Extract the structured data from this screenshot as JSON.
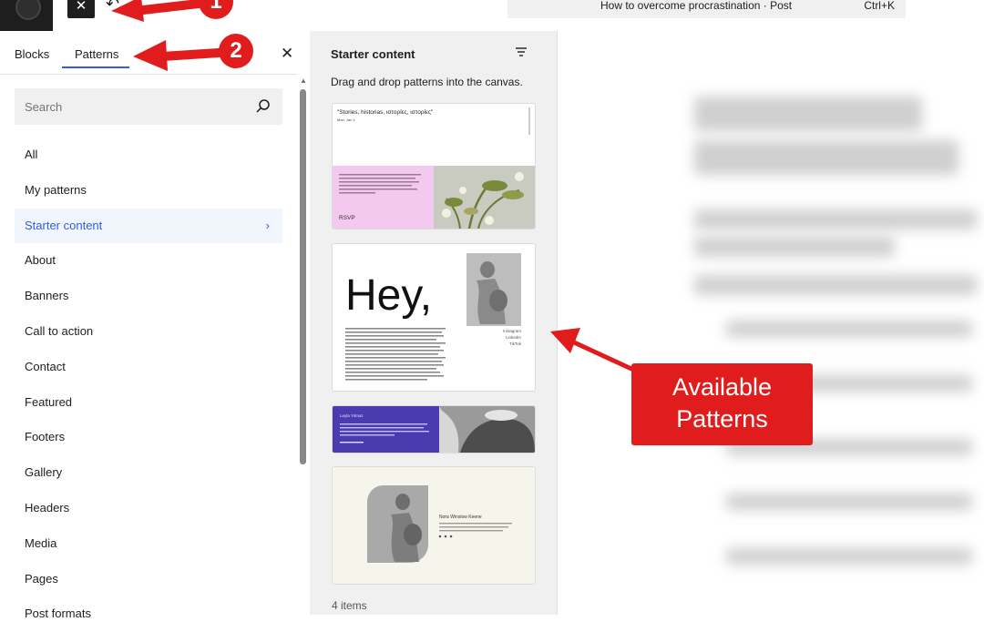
{
  "topbar": {
    "close_glyph": "✕",
    "undo_glyph": "↶",
    "document_title": "How to overcome procrastination · Post",
    "shortcut": "Ctrl+K"
  },
  "inserter": {
    "tabs": [
      {
        "label": "Blocks",
        "active": false
      },
      {
        "label": "Patterns",
        "active": true
      }
    ],
    "close_glyph": "✕",
    "search": {
      "placeholder": "Search",
      "value": ""
    },
    "categories": [
      {
        "label": "All"
      },
      {
        "label": "My patterns"
      },
      {
        "label": "Starter content",
        "selected": true
      },
      {
        "label": "About"
      },
      {
        "label": "Banners"
      },
      {
        "label": "Call to action"
      },
      {
        "label": "Contact"
      },
      {
        "label": "Featured"
      },
      {
        "label": "Footers"
      },
      {
        "label": "Gallery"
      },
      {
        "label": "Headers"
      },
      {
        "label": "Media"
      },
      {
        "label": "Pages"
      },
      {
        "label": "Post formats"
      }
    ],
    "chevron_glyph": "›"
  },
  "patterns_panel": {
    "title": "Starter content",
    "description": "Drag and drop patterns into the canvas.",
    "count_label": "4 items",
    "cards": [
      {
        "heading": "\"Stories, historias, ιστορίες, ιστορίες\"",
        "date": "Mon, Jan 1",
        "button": "RSVP"
      },
      {
        "big_text": "Hey,",
        "links": [
          "Instagram",
          "LinkedIn",
          "TikTok"
        ]
      },
      {
        "name": "Leyla Yılmaz"
      },
      {
        "name": "Nora Winslow Keene"
      }
    ]
  },
  "annotations": {
    "badge_1": "1",
    "badge_2": "2",
    "callout_line1": "Available",
    "callout_line2": "Patterns"
  },
  "colors": {
    "accent": "#3858e9",
    "annotation_red": "#e01c1c",
    "dark": "#1e1e1e",
    "pink_card": "#f3c9ef",
    "purple_card": "#4a3cb0"
  },
  "icons": {
    "search": "search-icon",
    "filter": "filter-icon",
    "wordpress_logo": "wordpress-logo-icon"
  }
}
